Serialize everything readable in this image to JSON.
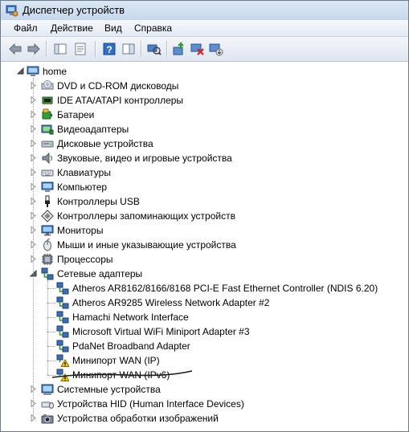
{
  "window": {
    "title": "Диспетчер устройств"
  },
  "menu": [
    {
      "key": "file",
      "label": "Файл"
    },
    {
      "key": "action",
      "label": "Действие"
    },
    {
      "key": "view",
      "label": "Вид"
    },
    {
      "key": "help",
      "label": "Справка"
    }
  ],
  "toolbar": [
    {
      "name": "back-icon"
    },
    {
      "name": "forward-icon"
    },
    {
      "name": "show-hide-tree-icon"
    },
    {
      "name": "properties-icon"
    },
    {
      "name": "help-icon"
    },
    {
      "name": "show-hide-action-pane-icon"
    },
    {
      "name": "scan-hardware-icon"
    },
    {
      "name": "update-driver-icon"
    },
    {
      "name": "disable-device-icon"
    },
    {
      "name": "uninstall-device-icon"
    }
  ],
  "tree": {
    "root": {
      "label": "home",
      "icon": "computer-icon"
    },
    "categories": [
      {
        "label": "DVD и CD-ROM дисководы",
        "icon": "dvd-drive-icon"
      },
      {
        "label": "IDE ATA/ATAPI контроллеры",
        "icon": "ide-controller-icon"
      },
      {
        "label": "Батареи",
        "icon": "battery-icon"
      },
      {
        "label": "Видеоадаптеры",
        "icon": "display-adapter-icon"
      },
      {
        "label": "Дисковые устройства",
        "icon": "disk-drive-icon"
      },
      {
        "label": "Звуковые, видео и игровые устройства",
        "icon": "sound-device-icon"
      },
      {
        "label": "Клавиатуры",
        "icon": "keyboard-icon"
      },
      {
        "label": "Компьютер",
        "icon": "computer-icon"
      },
      {
        "label": "Контроллеры USB",
        "icon": "usb-icon"
      },
      {
        "label": "Контроллеры запоминающих устройств",
        "icon": "storage-controller-icon"
      },
      {
        "label": "Мониторы",
        "icon": "monitor-icon"
      },
      {
        "label": "Мыши и иные указывающие устройства",
        "icon": "mouse-icon"
      },
      {
        "label": "Процессоры",
        "icon": "processor-icon"
      },
      {
        "label": "Сетевые адаптеры",
        "icon": "network-adapter-icon",
        "expanded": true,
        "children": [
          {
            "label": "Atheros AR8162/8166/8168 PCI-E Fast Ethernet Controller (NDIS 6.20)",
            "icon": "network-adapter-icon",
            "warning": false
          },
          {
            "label": "Atheros AR9285 Wireless Network Adapter #2",
            "icon": "network-adapter-icon",
            "warning": false
          },
          {
            "label": "Hamachi Network Interface",
            "icon": "network-adapter-icon",
            "warning": false
          },
          {
            "label": "Microsoft Virtual WiFi Miniport Adapter #3",
            "icon": "network-adapter-icon",
            "warning": false
          },
          {
            "label": "PdaNet Broadband Adapter",
            "icon": "network-adapter-icon",
            "warning": false
          },
          {
            "label": "Минипорт WAN (IP)",
            "icon": "network-adapter-warning-icon",
            "warning": true
          },
          {
            "label": "Минипорт WAN (IPv6)",
            "icon": "network-adapter-warning-icon",
            "warning": true
          }
        ]
      },
      {
        "label": "Системные устройства",
        "icon": "system-device-icon"
      },
      {
        "label": "Устройства HID (Human Interface Devices)",
        "icon": "hid-device-icon"
      },
      {
        "label": "Устройства обработки изображений",
        "icon": "imaging-device-icon"
      }
    ]
  },
  "colors": {
    "warning": "#f5c400",
    "annotation_ink": "#1a1a1a",
    "selection": "#cce8ff"
  }
}
